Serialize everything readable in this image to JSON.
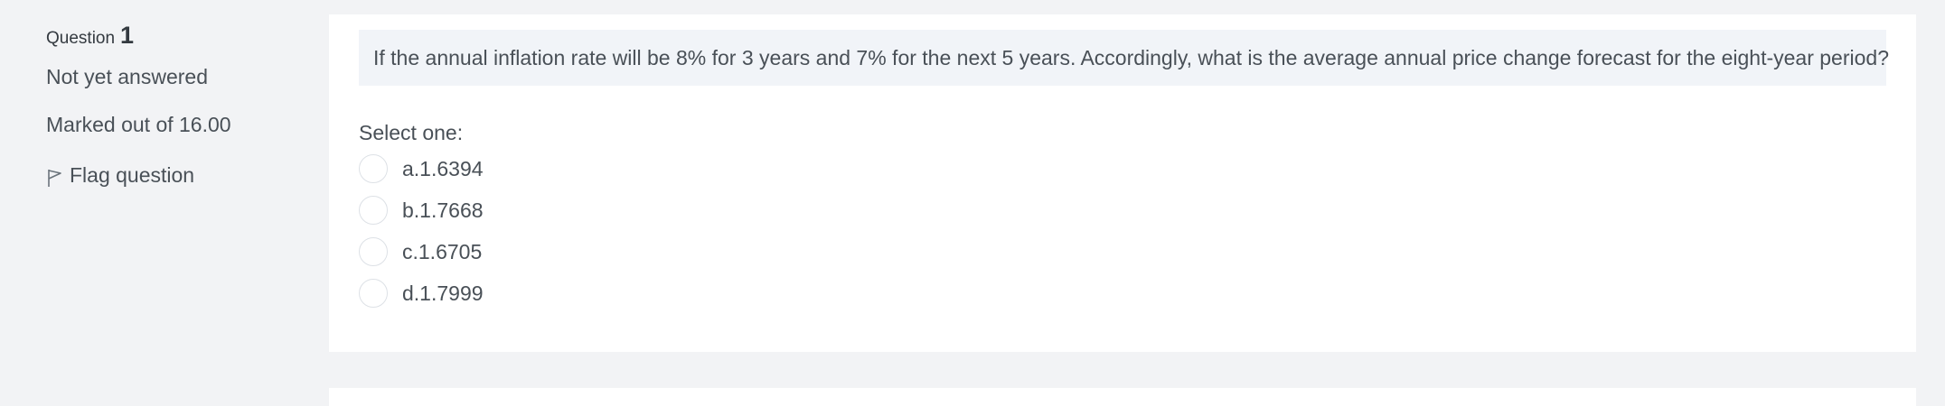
{
  "info": {
    "question_label": "Question",
    "question_number": "1",
    "state": "Not yet answered",
    "grade": "Marked out of 16.00",
    "flag_label": "Flag question",
    "flag_icon": "flag-icon"
  },
  "question": {
    "text": "If the annual inflation rate will be 8% for 3 years and 7% for the next 5 years. Accordingly, what is the average annual price change forecast for the eight-year period?",
    "prompt": "Select one:",
    "answers": [
      {
        "label": "a.1.6394"
      },
      {
        "label": "b.1.7668"
      },
      {
        "label": "c.1.6705"
      },
      {
        "label": "d.1.7999"
      }
    ]
  }
}
